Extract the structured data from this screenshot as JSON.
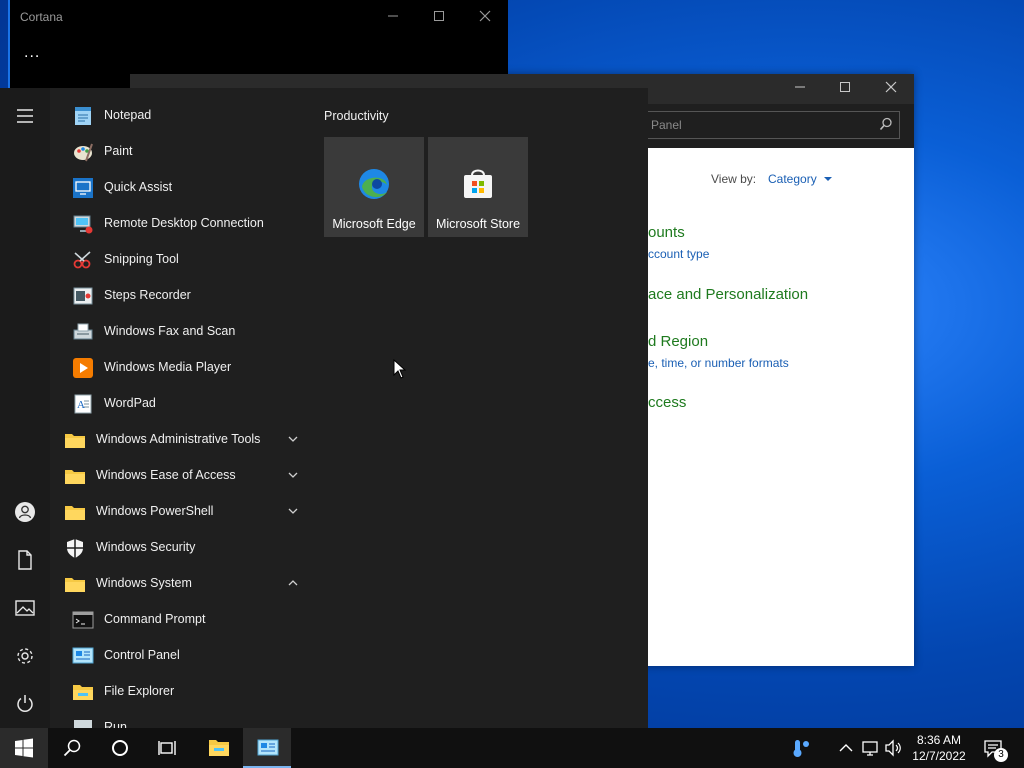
{
  "cortana": {
    "title": "Cortana",
    "more": "..."
  },
  "control_panel": {
    "search_placeholder": "Panel",
    "view_by_label": "View by:",
    "view_by_value": "Category",
    "categories": [
      {
        "heading": "ounts",
        "sub": "ccount type"
      },
      {
        "heading": "ace and Personalization",
        "sub": ""
      },
      {
        "heading": "d Region",
        "sub": "e, time, or number formats"
      },
      {
        "heading": "ccess",
        "sub": ""
      }
    ]
  },
  "start_menu": {
    "apps": [
      {
        "label": "Notepad",
        "icon": "notepad-icon"
      },
      {
        "label": "Paint",
        "icon": "paint-icon"
      },
      {
        "label": "Quick Assist",
        "icon": "quick-assist-icon"
      },
      {
        "label": "Remote Desktop Connection",
        "icon": "remote-desktop-icon"
      },
      {
        "label": "Snipping Tool",
        "icon": "snipping-tool-icon"
      },
      {
        "label": "Steps Recorder",
        "icon": "steps-recorder-icon"
      },
      {
        "label": "Windows Fax and Scan",
        "icon": "fax-scan-icon"
      },
      {
        "label": "Windows Media Player",
        "icon": "media-player-icon"
      },
      {
        "label": "WordPad",
        "icon": "wordpad-icon"
      }
    ],
    "folders": [
      {
        "label": "Windows Administrative Tools",
        "expanded": false
      },
      {
        "label": "Windows Ease of Access",
        "expanded": false
      },
      {
        "label": "Windows PowerShell",
        "expanded": false
      },
      {
        "label": "Windows Security",
        "icon": "shield-icon"
      },
      {
        "label": "Windows System",
        "expanded": true
      }
    ],
    "system_apps": [
      {
        "label": "Command Prompt",
        "icon": "command-prompt-icon"
      },
      {
        "label": "Control Panel",
        "icon": "control-panel-icon"
      },
      {
        "label": "File Explorer",
        "icon": "file-explorer-icon"
      },
      {
        "label": "Run",
        "icon": "run-icon"
      }
    ],
    "tiles_group": "Productivity",
    "tiles": [
      {
        "label": "Microsoft Edge",
        "icon": "edge-icon"
      },
      {
        "label": "Microsoft Store",
        "icon": "store-icon"
      }
    ]
  },
  "taskbar": {
    "time": "8:36 AM",
    "date": "12/7/2022",
    "notifications": "3"
  },
  "colors": {
    "accent": "#0078d7",
    "link": "#1a5fb4",
    "category_green": "#1e7a1e"
  }
}
